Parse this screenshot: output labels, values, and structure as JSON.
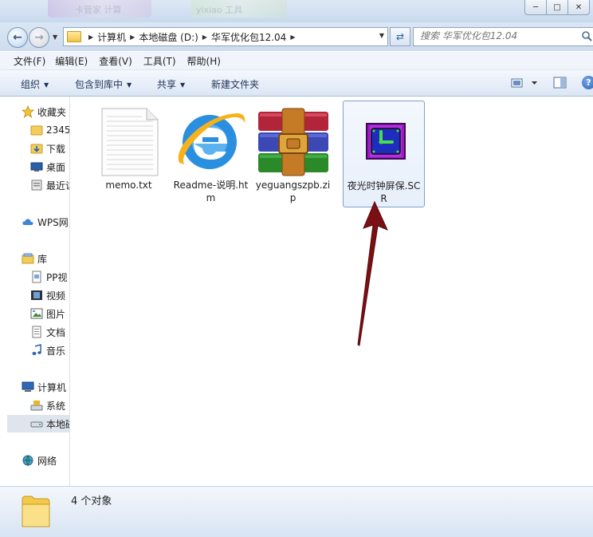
{
  "window": {
    "blurred_tab_1": "卡管家 计算",
    "blurred_tab_2": "yixiao 工具"
  },
  "titlebar_buttons": {
    "minimize": "─",
    "maximize": "□",
    "close": "✕"
  },
  "address": {
    "crumbs": [
      "计算机",
      "本地磁盘 (D:)",
      "华军优化包12.04"
    ],
    "search_placeholder": "搜索 华军优化包12.04"
  },
  "menu": [
    "文件(F)",
    "编辑(E)",
    "查看(V)",
    "工具(T)",
    "帮助(H)"
  ],
  "toolbar": {
    "organize": "组织",
    "include_in_library": "包含到库中",
    "share": "共享",
    "new_folder": "新建文件夹"
  },
  "nav": {
    "favorites": "收藏夹",
    "fav_items": [
      "2345",
      "下载",
      "桌面",
      "最近访"
    ],
    "wps": "WPS网",
    "libraries": "库",
    "lib_items": [
      "PP视",
      "视频",
      "图片",
      "文档",
      "音乐"
    ],
    "computer": "计算机",
    "computer_items": [
      "系统",
      "本地磁"
    ],
    "network": "网络"
  },
  "files": [
    {
      "name": "memo.txt",
      "icon": "text-file-icon",
      "selected": false
    },
    {
      "name": "Readme-说明.htm",
      "icon": "internet-explorer-icon",
      "selected": false
    },
    {
      "name": "yeguangszpb.zip",
      "icon": "winrar-archive-icon",
      "selected": false
    },
    {
      "name": "夜光时钟屏保.SCR",
      "icon": "clock-screensaver-icon",
      "selected": true
    }
  ],
  "status": {
    "count": "4 个对象"
  },
  "colors": {
    "arrow": "#7a0f14",
    "selection_border": "#7da2ce"
  }
}
